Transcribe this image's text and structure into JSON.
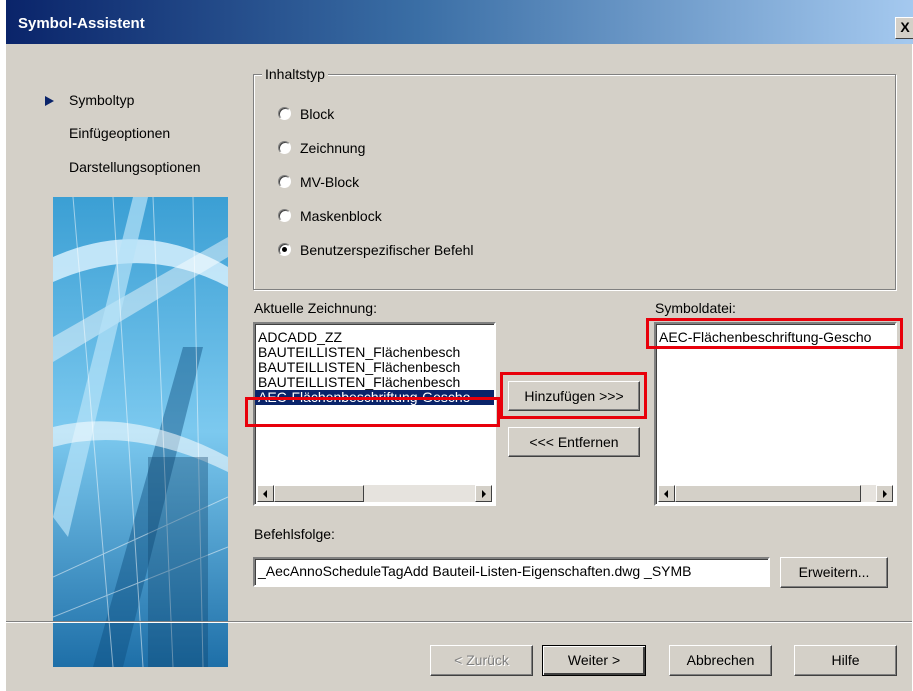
{
  "window": {
    "title": "Symbol-Assistent",
    "close_glyph": "X"
  },
  "nav": {
    "items": [
      "Symboltyp",
      "Einfügeoptionen",
      "Darstellungsoptionen"
    ],
    "active_index": 0
  },
  "content_type": {
    "legend": "Inhaltstyp",
    "options": [
      "Block",
      "Zeichnung",
      "MV-Block",
      "Maskenblock",
      "Benutzerspezifischer Befehl"
    ],
    "selected_index": 4
  },
  "current_drawing": {
    "label": "Aktuelle Zeichnung:",
    "items": [
      "ADCADD_ZZ",
      "BAUTEILLISTEN_Flächenbesch",
      "BAUTEILLISTEN_Flächenbesch",
      "BAUTEILLISTEN_Flächenbesch",
      "AEC-Flächenbeschriftung-Gescho"
    ],
    "selected_index": 4
  },
  "symbol_file": {
    "label": "Symboldatei:",
    "items": [
      "AEC-Flächenbeschriftung-Gescho"
    ]
  },
  "buttons": {
    "add": "Hinzufügen >>>",
    "remove": "<<< Entfernen",
    "advanced": "Erweitern...",
    "back": "< Zurück",
    "next": "Weiter >",
    "cancel": "Abbrechen",
    "help": "Hilfe"
  },
  "command": {
    "label": "Befehlsfolge:",
    "value": "_AecAnnoScheduleTagAdd Bauteil-Listen-Eigenschaften.dwg _SYMB"
  },
  "colors": {
    "title_bar": "#0a246a",
    "highlight_box": "#e8000b",
    "selection": "#0a246a",
    "dialog_bg": "#d4d0c8"
  }
}
